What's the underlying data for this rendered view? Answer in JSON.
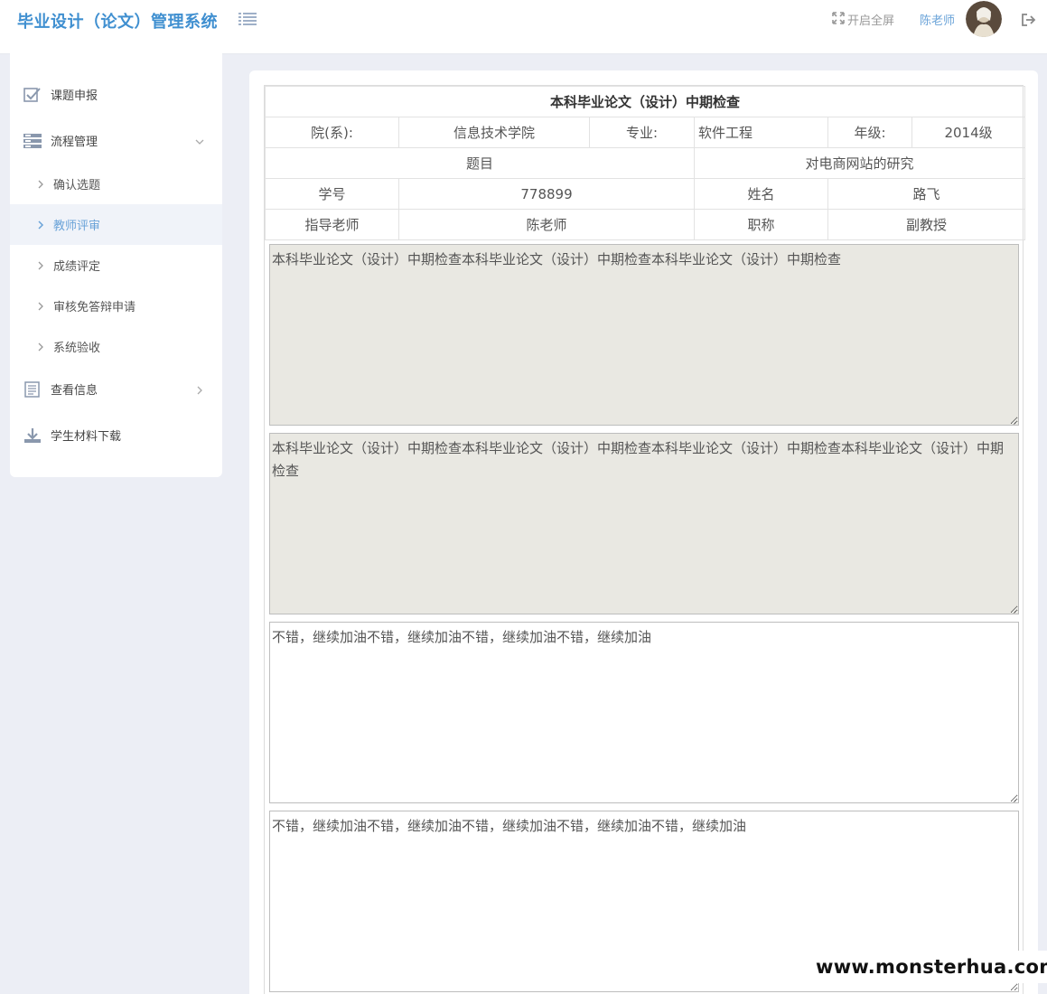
{
  "header": {
    "brand": "毕业设计（论文）管理系统",
    "fullscreen_label": "开启全屏",
    "username": "陈老师",
    "icons": {
      "menu": "list-icon",
      "fullscreen": "expand-icon",
      "logout": "logout-icon"
    }
  },
  "sidebar": {
    "items": [
      {
        "label": "课题申报",
        "icon": "checkbox-icon"
      },
      {
        "label": "流程管理",
        "icon": "server-icon",
        "expanded": true
      },
      {
        "label": "查看信息",
        "icon": "document-icon"
      },
      {
        "label": "学生材料下载",
        "icon": "download-icon"
      }
    ],
    "sub_items": [
      {
        "label": "确认选题"
      },
      {
        "label": "教师评审",
        "active": true
      },
      {
        "label": "成绩评定"
      },
      {
        "label": "审核免答辩申请"
      },
      {
        "label": "系统验收"
      }
    ]
  },
  "form": {
    "title": "本科毕业论文（设计）中期检查",
    "dept_label": "院(系):",
    "dept_value": "信息技术学院",
    "major_label": "专业:",
    "major_value": "软件工程",
    "grade_label": "年级:",
    "grade_value": "2014级",
    "topic_label": "题目",
    "topic_value": "对电商网站的研究",
    "student_id_label": "学号",
    "student_id_value": "778899",
    "name_label": "姓名",
    "name_value": "路飞",
    "advisor_label": "指导老师",
    "advisor_value": "陈老师",
    "rank_label": "职称",
    "rank_value": "副教授",
    "text_1": "本科毕业论文（设计）中期检查本科毕业论文（设计）中期检查本科毕业论文（设计）中期检查",
    "text_2": "本科毕业论文（设计）中期检查本科毕业论文（设计）中期检查本科毕业论文（设计）中期检查本科毕业论文（设计）中期检查",
    "comment_1": "不错，继续加油不错，继续加油不错，继续加油不错，继续加油",
    "comment_2": "不错，继续加油不错，继续加油不错，继续加油不错，继续加油不错，继续加油"
  },
  "watermark": "www.monsterhua.com",
  "colors": {
    "accent": "#3f8fd0",
    "link": "#6aa3d8",
    "page_bg": "#eceef5",
    "readonly_bg": "#e9e8e2"
  }
}
